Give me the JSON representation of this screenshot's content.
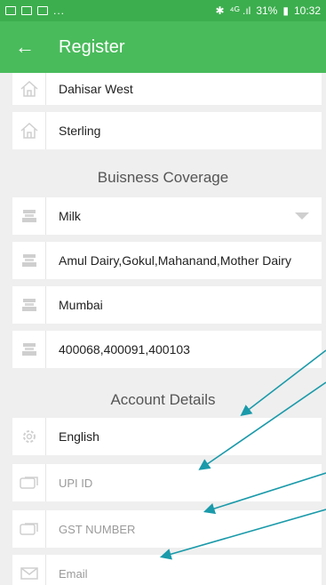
{
  "status_bar": {
    "battery": "31%",
    "time": "10:32",
    "dots": "...",
    "network": "⁴ᴳ .ıl"
  },
  "app_bar": {
    "title": "Register",
    "back_icon": "arrow-left-icon"
  },
  "address": [
    {
      "value": "Dahisar West",
      "icon": "home-icon"
    },
    {
      "value": "Sterling",
      "icon": "home-icon"
    }
  ],
  "business_coverage": {
    "heading": "Buisness Coverage",
    "fields": [
      {
        "value": "Milk",
        "icon": "shop-icon",
        "dropdown": true
      },
      {
        "value": "Amul Dairy,Gokul,Mahanand,Mother Dairy",
        "icon": "shop-icon"
      },
      {
        "value": "Mumbai",
        "icon": "shop-icon"
      },
      {
        "value": "400068,400091,400103",
        "icon": "shop-icon"
      }
    ]
  },
  "account_details": {
    "heading": "Account Details",
    "fields": [
      {
        "value": "English",
        "icon": "gear-icon",
        "placeholder": false
      },
      {
        "value": "UPI ID",
        "icon": "card-icon",
        "placeholder": true
      },
      {
        "value": "GST NUMBER",
        "icon": "card-icon",
        "placeholder": true
      },
      {
        "value": "Email",
        "icon": "envelope-icon",
        "placeholder": true
      }
    ]
  },
  "annotation_color": "#1a9aaa"
}
